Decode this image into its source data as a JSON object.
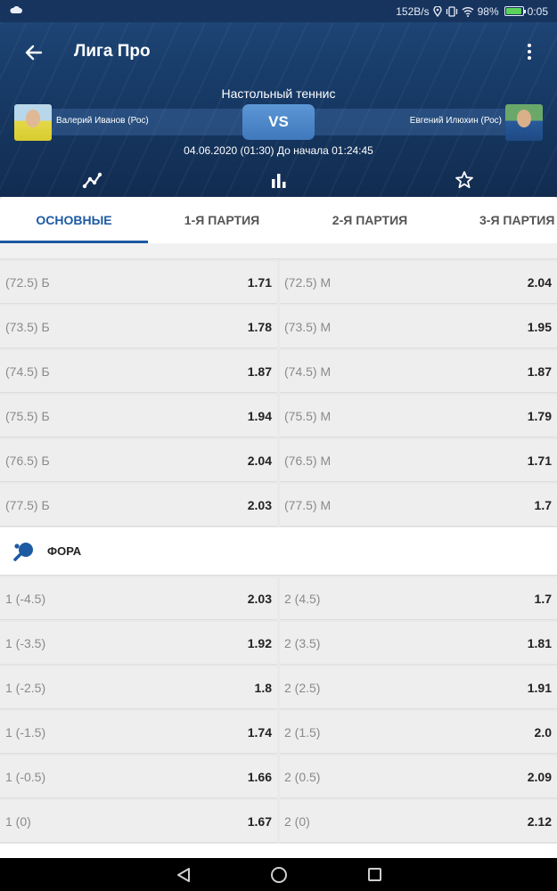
{
  "status_bar": {
    "speed": "152B/s",
    "battery": "98%",
    "time": "0:05"
  },
  "header": {
    "title": "Лига Про",
    "sport": "Настольный теннис",
    "player_left": "Валерий Иванов (Рос)",
    "player_right": "Евгений Илюхин (Рос)",
    "vs": "VS",
    "datetime": "04.06.2020 (01:30)  До начала 01:24:45"
  },
  "tabs": [
    "ОСНОВНЫЕ",
    "1-Я ПАРТИЯ",
    "2-Я ПАРТИЯ",
    "3-Я ПАРТИЯ"
  ],
  "totals": [
    {
      "l_label": "(72.5) Б",
      "l_odd": "1.71",
      "r_label": "(72.5) М",
      "r_odd": "2.04"
    },
    {
      "l_label": "(73.5) Б",
      "l_odd": "1.78",
      "r_label": "(73.5) М",
      "r_odd": "1.95"
    },
    {
      "l_label": "(74.5) Б",
      "l_odd": "1.87",
      "r_label": "(74.5) М",
      "r_odd": "1.87"
    },
    {
      "l_label": "(75.5) Б",
      "l_odd": "1.94",
      "r_label": "(75.5) М",
      "r_odd": "1.79"
    },
    {
      "l_label": "(76.5) Б",
      "l_odd": "2.04",
      "r_label": "(76.5) М",
      "r_odd": "1.71"
    },
    {
      "l_label": "(77.5) Б",
      "l_odd": "2.03",
      "r_label": "(77.5) М",
      "r_odd": "1.7"
    }
  ],
  "handicap_section": {
    "title": "ФОРА",
    "icon": "ping-pong-paddle-icon"
  },
  "handicap": [
    {
      "l_label": "1 (-4.5)",
      "l_odd": "2.03",
      "r_label": "2 (4.5)",
      "r_odd": "1.7"
    },
    {
      "l_label": "1 (-3.5)",
      "l_odd": "1.92",
      "r_label": "2 (3.5)",
      "r_odd": "1.81"
    },
    {
      "l_label": "1 (-2.5)",
      "l_odd": "1.8",
      "r_label": "2 (2.5)",
      "r_odd": "1.91"
    },
    {
      "l_label": "1 (-1.5)",
      "l_odd": "1.74",
      "r_label": "2 (1.5)",
      "r_odd": "2.0"
    },
    {
      "l_label": "1 (-0.5)",
      "l_odd": "1.66",
      "r_label": "2 (0.5)",
      "r_odd": "2.09"
    },
    {
      "l_label": "1 (0)",
      "l_odd": "1.67",
      "r_label": "2 (0)",
      "r_odd": "2.12"
    }
  ],
  "colors": {
    "header_bg": "#173a66",
    "accent": "#1d5aa3",
    "vs_button": "#4a86c8"
  }
}
